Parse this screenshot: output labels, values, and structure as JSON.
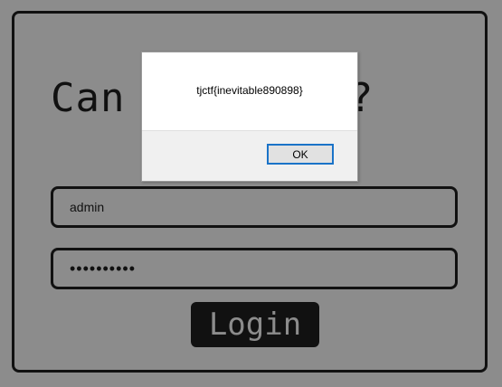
{
  "login_form": {
    "heading": "Can I log in?",
    "username_value": "admin",
    "password_value": "••••••••••",
    "login_label": "Login"
  },
  "alert": {
    "message": "tjctf{inevitable890898}",
    "ok_label": "OK"
  },
  "colors": {
    "background": "#8c8c8c",
    "border": "#111111",
    "button_bg": "#111111",
    "button_text": "#8c8c8c",
    "dialog_focus": "#1a73c8"
  }
}
